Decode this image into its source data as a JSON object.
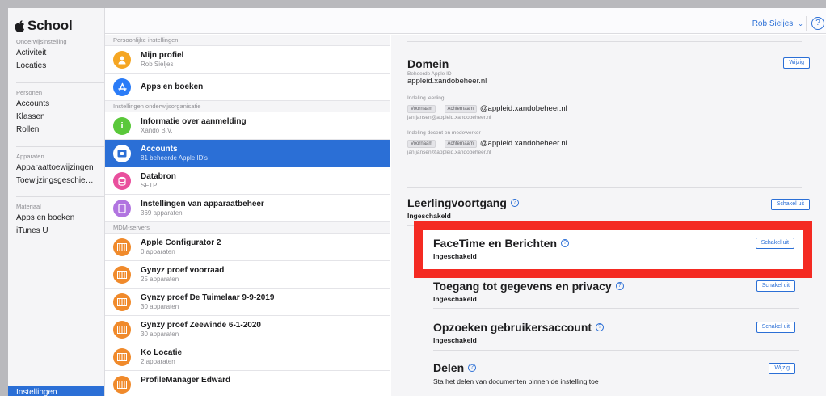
{
  "app": {
    "brand": "School"
  },
  "sidebar": {
    "groups": [
      {
        "head": "Onderwijsinstelling",
        "items": [
          "Activiteit",
          "Locaties"
        ]
      },
      {
        "head": "Personen",
        "items": [
          "Accounts",
          "Klassen",
          "Rollen"
        ]
      },
      {
        "head": "Apparaten",
        "items": [
          "Apparaattoewijzingen",
          "Toewijzingsgeschiede..."
        ]
      },
      {
        "head": "Materiaal",
        "items": [
          "Apps en boeken",
          "iTunes U"
        ]
      }
    ],
    "bottom": "Instellingen"
  },
  "topbar": {
    "user": "Rob Sieljes",
    "help": "?"
  },
  "middle": {
    "sections": [
      "Persoonlijke instellingen",
      "Instellingen onderwijsorganisatie",
      "MDM-servers"
    ],
    "rows": [
      {
        "title": "Mijn profiel",
        "sub": "Rob Sieljes",
        "icon": "profile-icon",
        "color": "#f5a623"
      },
      {
        "title": "Apps en boeken",
        "sub": "",
        "icon": "app-store-icon",
        "color": "#2b7cf7"
      },
      {
        "title": "Informatie over aanmelding",
        "sub": "Xando B.V.",
        "icon": "info-icon",
        "color": "#5ac83a"
      },
      {
        "title": "Accounts",
        "sub": "81 beheerde Apple ID's",
        "icon": "accounts-icon",
        "color": "#2b6fd6"
      },
      {
        "title": "Databron",
        "sub": "SFTP",
        "icon": "database-icon",
        "color": "#e94f9d"
      },
      {
        "title": "Instellingen van apparaatbeheer",
        "sub": "369 apparaten",
        "icon": "device-icon",
        "color": "#b174e0"
      },
      {
        "title": "Apple Configurator 2",
        "sub": "0 apparaten",
        "icon": "server-icon",
        "color": "#f08a2b"
      },
      {
        "title": "Gynyz proef voorraad",
        "sub": "25 apparaten",
        "icon": "server-icon",
        "color": "#f08a2b"
      },
      {
        "title": "Gynzy proef De Tuimelaar 9-9-2019",
        "sub": "30 apparaten",
        "icon": "server-icon",
        "color": "#f08a2b"
      },
      {
        "title": "Gynzy proef Zeewinde 6-1-2020",
        "sub": "30 apparaten",
        "icon": "server-icon",
        "color": "#f08a2b"
      },
      {
        "title": "Ko Locatie",
        "sub": "2 apparaten",
        "icon": "server-icon",
        "color": "#f08a2b"
      },
      {
        "title": "ProfileManager Edward",
        "sub": "",
        "icon": "server-icon",
        "color": "#f08a2b"
      }
    ]
  },
  "content": {
    "domain": {
      "title": "Domein",
      "button": "Wijzig",
      "managed_label": "Beheerde Apple ID",
      "managed_value": "appleid.xandobeheer.nl",
      "student_label": "Indeling leerling",
      "teacher_label": "Indeling docent en medewerker",
      "pill_first": "Voornaam",
      "pill_dot": "·",
      "pill_last": "Achternaam",
      "domain_suffix": "@appleid.xandobeheer.nl",
      "example": "jan.jansen@appleid.xandobeheer.nl"
    },
    "progress": {
      "title": "Leerlingvoortgang",
      "status": "Ingeschakeld",
      "button": "Schakel uit"
    },
    "facetime": {
      "title": "FaceTime en Berichten",
      "status": "Ingeschakeld",
      "button": "Schakel uit"
    },
    "privacy": {
      "title": "Toegang tot gegevens en privacy",
      "status": "Ingeschakeld",
      "button": "Schakel uit"
    },
    "lookup": {
      "title": "Opzoeken gebruikersaccount",
      "status": "Ingeschakeld",
      "button": "Schakel uit"
    },
    "share": {
      "title": "Delen",
      "desc": "Sta het delen van documenten binnen de instelling toe",
      "button": "Wijzig"
    }
  },
  "colors": {
    "accent": "#2b6fd6",
    "highlight": "#f42a22"
  }
}
